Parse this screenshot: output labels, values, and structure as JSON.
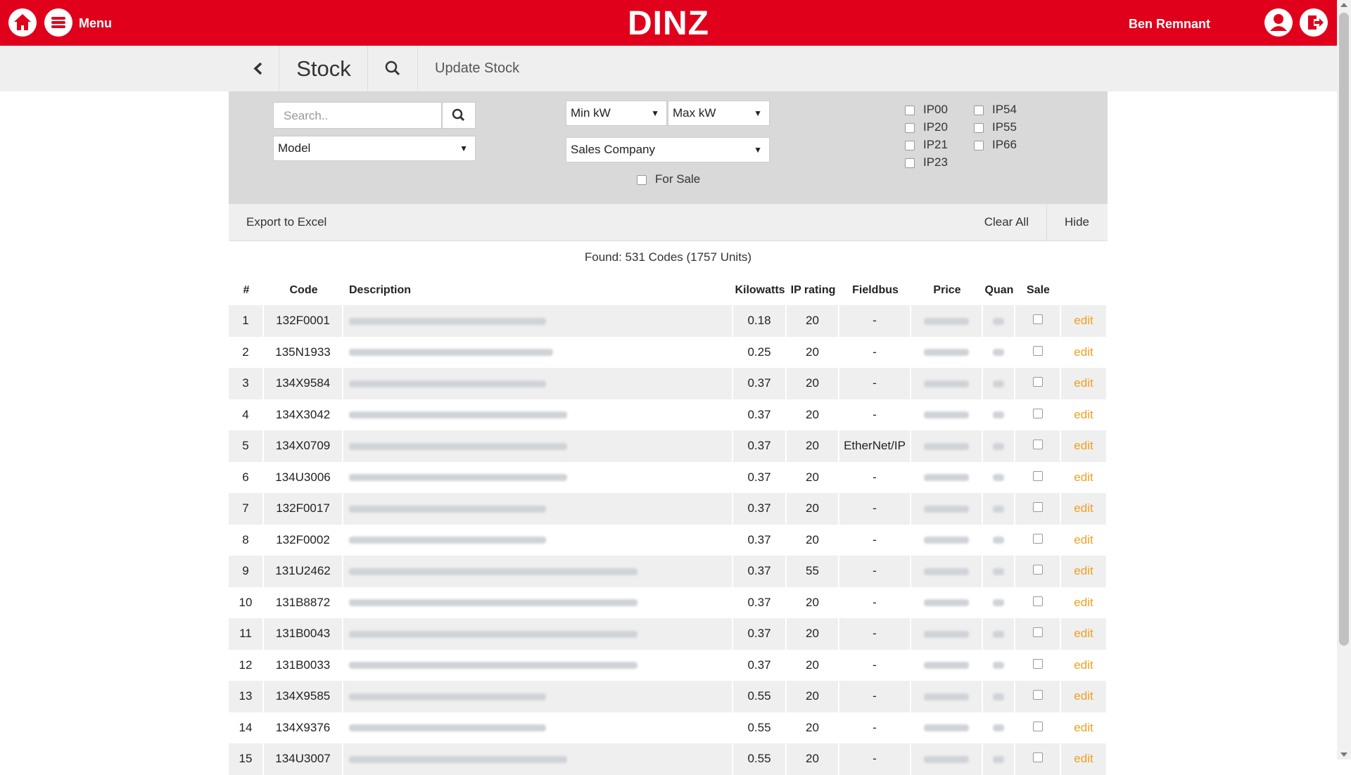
{
  "header": {
    "menu_label": "Menu",
    "brand": "DINZ",
    "user_name": "Ben Remnant"
  },
  "subnav": {
    "title": "Stock",
    "update_label": "Update Stock"
  },
  "filters": {
    "search_placeholder": "Search..",
    "model_label": "Model",
    "min_kw_label": "Min kW",
    "max_kw_label": "Max kW",
    "sales_company_label": "Sales Company",
    "for_sale_label": "For Sale",
    "ip_ratings": [
      "IP00",
      "IP20",
      "IP21",
      "IP23",
      "IP54",
      "IP55",
      "IP66"
    ]
  },
  "actions": {
    "export_label": "Export to Excel",
    "clear_label": "Clear All",
    "hide_label": "Hide"
  },
  "found_text": "Found: 531 Codes (1757 Units)",
  "table": {
    "columns": [
      "#",
      "Code",
      "Description",
      "Kilowatts",
      "IP rating",
      "Fieldbus",
      "Price",
      "Quan",
      "Sale",
      ""
    ],
    "edit_label": "edit",
    "rows": [
      {
        "num": "1",
        "code": "132F0001",
        "kw": "0.18",
        "ip": "20",
        "fieldbus": "-"
      },
      {
        "num": "2",
        "code": "135N1933",
        "kw": "0.25",
        "ip": "20",
        "fieldbus": "-"
      },
      {
        "num": "3",
        "code": "134X9584",
        "kw": "0.37",
        "ip": "20",
        "fieldbus": "-"
      },
      {
        "num": "4",
        "code": "134X3042",
        "kw": "0.37",
        "ip": "20",
        "fieldbus": "-"
      },
      {
        "num": "5",
        "code": "134X0709",
        "kw": "0.37",
        "ip": "20",
        "fieldbus": "EtherNet/IP"
      },
      {
        "num": "6",
        "code": "134U3006",
        "kw": "0.37",
        "ip": "20",
        "fieldbus": "-"
      },
      {
        "num": "7",
        "code": "132F0017",
        "kw": "0.37",
        "ip": "20",
        "fieldbus": "-"
      },
      {
        "num": "8",
        "code": "132F0002",
        "kw": "0.37",
        "ip": "20",
        "fieldbus": "-"
      },
      {
        "num": "9",
        "code": "131U2462",
        "kw": "0.37",
        "ip": "55",
        "fieldbus": "-"
      },
      {
        "num": "10",
        "code": "131B8872",
        "kw": "0.37",
        "ip": "20",
        "fieldbus": "-"
      },
      {
        "num": "11",
        "code": "131B0043",
        "kw": "0.37",
        "ip": "20",
        "fieldbus": "-"
      },
      {
        "num": "12",
        "code": "131B0033",
        "kw": "0.37",
        "ip": "20",
        "fieldbus": "-"
      },
      {
        "num": "13",
        "code": "134X9585",
        "kw": "0.55",
        "ip": "20",
        "fieldbus": "-"
      },
      {
        "num": "14",
        "code": "134X9376",
        "kw": "0.55",
        "ip": "20",
        "fieldbus": "-"
      },
      {
        "num": "15",
        "code": "134U3007",
        "kw": "0.55",
        "ip": "20",
        "fieldbus": "-"
      }
    ]
  }
}
